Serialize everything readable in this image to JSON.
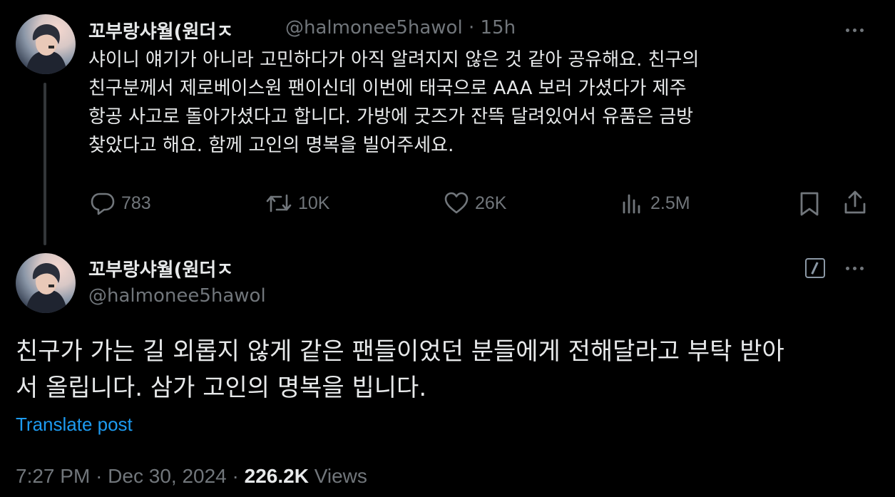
{
  "first_tweet": {
    "display_name": "꼬부랑샤월(원더ㅈ",
    "handle": "@halmonee5hawol",
    "separator": "·",
    "time_ago": "15h",
    "text_lines": [
      "샤이니 얘기가 아니라 고민하다가 아직 알려지지 않은 것 같아 공유해요. 친구의",
      "친구분께서 제로베이스원 팬이신데 이번에 태국으로 AAA 보러 가셨다가 제주",
      "항공 사고로 돌아가셨다고 합니다. 가방에 굿즈가 잔뜩 달려있어서 유품은 금방",
      "찾았다고 해요. 함께 고인의 명복을 빌어주세요."
    ],
    "stats": {
      "replies": "783",
      "reposts": "10K",
      "likes": "26K",
      "views": "2.5M"
    }
  },
  "reply_tweet": {
    "display_name": "꼬부랑샤월(원더ㅈ",
    "handle": "@halmonee5hawol",
    "text_lines": [
      "친구가 가는 길 외롭지 않게 같은 팬들이었던 분들에게 전해달라고 부탁 받아",
      "서 올립니다. 삼가 고인의 명복을 빕니다."
    ],
    "translate_label": "Translate post",
    "time": "7:27 PM",
    "date": "Dec 30, 2024",
    "views_count": "226.2K",
    "views_label": "Views"
  },
  "icons": {
    "reply": "reply-icon",
    "repost": "repost-icon",
    "like": "heart-icon",
    "views": "analytics-icon",
    "bookmark": "bookmark-icon",
    "share": "share-icon",
    "more": "more-icon",
    "edit": "edit-icon"
  },
  "colors": {
    "background": "#000000",
    "text": "#e7e9ea",
    "muted": "#71767b",
    "link": "#1d9bf0"
  }
}
